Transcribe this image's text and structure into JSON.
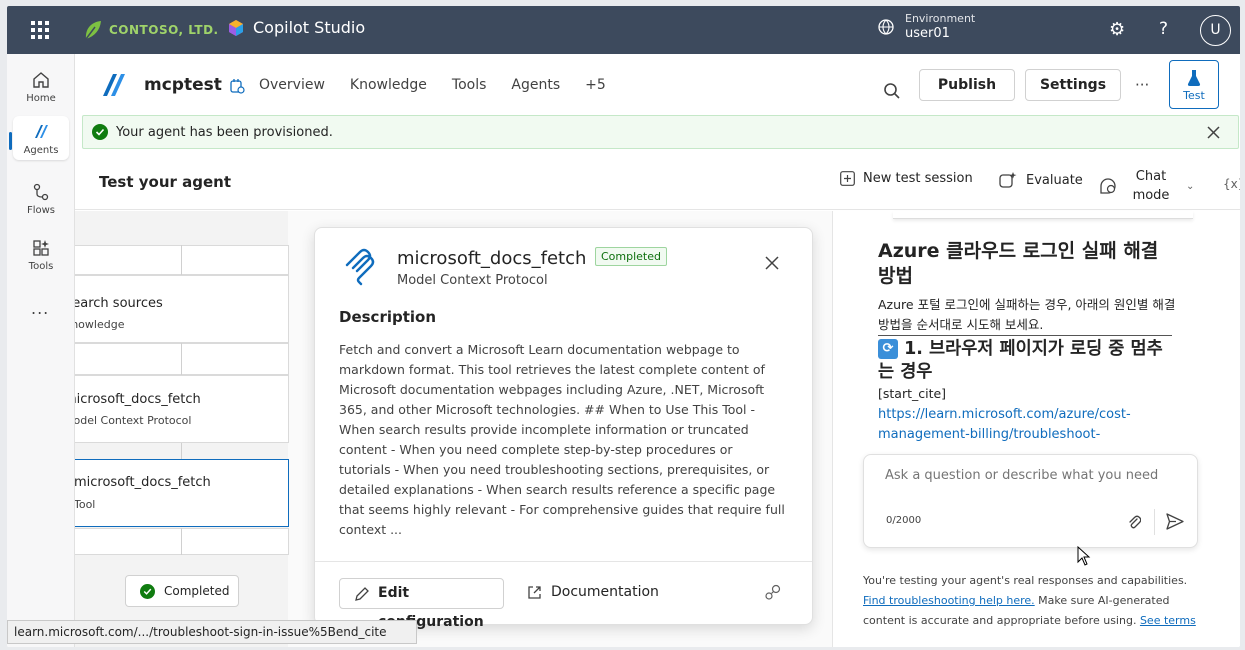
{
  "topbar": {
    "brand": "CONTOSO, LTD.",
    "product": "Copilot Studio",
    "env_label": "Environment",
    "env_user": "user01",
    "avatar_initial": "U"
  },
  "rail": {
    "items": [
      {
        "label": "Home",
        "icon": "home-icon"
      },
      {
        "label": "Agents",
        "icon": "agents-icon"
      },
      {
        "label": "Flows",
        "icon": "flows-icon"
      },
      {
        "label": "Tools",
        "icon": "tools-icon"
      }
    ],
    "more": "..."
  },
  "agent": {
    "name": "mcptest",
    "nav": [
      "Overview",
      "Knowledge",
      "Tools",
      "Agents",
      "+5"
    ],
    "publish": "Publish",
    "settings": "Settings",
    "more": "···",
    "test": "Test"
  },
  "banner": {
    "text": "Your agent has been provisioned."
  },
  "test_panel": {
    "title": "Test your agent",
    "new_session": "New test session",
    "evaluate": "Evaluate",
    "chat_mode": "Chat mode",
    "vars": "{x}"
  },
  "canvas": {
    "nodes": [
      {
        "title": "Search sources",
        "sub": "Knowledge"
      },
      {
        "title": "microsoft_docs_fetch",
        "sub": "Model Context Protocol"
      },
      {
        "title": "microsoft_docs_fetch",
        "sub": "Tool"
      }
    ],
    "completed": "Completed"
  },
  "card": {
    "title": "microsoft_docs_fetch",
    "badge": "Completed",
    "subtitle": "Model Context Protocol",
    "desc_heading": "Description",
    "description": "Fetch and convert a Microsoft Learn documentation webpage to markdown format. This tool retrieves the latest complete content of Microsoft documentation webpages including Azure, .NET, Microsoft 365, and other Microsoft technologies. ## When to Use This Tool - When search results provide incomplete information or truncated content - When you need complete step-by-step procedures or tutorials - When you need troubleshooting sections, prerequisites, or detailed explanations - When search results reference a specific page that seems highly relevant - For comprehensive guides that require full context ...",
    "edit": "Edit configuration",
    "docs": "Documentation"
  },
  "chat": {
    "heading": "Azure 클라우드 로그인 실패 해결 방법",
    "intro": "Azure 포털 로그인에 실패하는 경우, 아래의 원인별 해결 방법을 순서대로 시도해 보세요.",
    "section": "1. 브라우저 페이지가 로딩 중 멈추는 경우",
    "cite": "[start_cite]",
    "link": "https://learn.microsoft.com/azure/cost-management-billing/troubleshoot-",
    "input_placeholder": "Ask a question or describe what you need",
    "counter": "0/2000",
    "disclaimer_1": "You're testing your agent's real responses and capabilities. ",
    "disclaimer_link_1": "Find troubleshooting help here.",
    "disclaimer_2": " Make sure AI-generated content is accurate and appropriate before using. ",
    "disclaimer_link_2": "See terms"
  },
  "status_url": "learn.microsoft.com/.../troubleshoot-sign-in-issue%5Bend_cite",
  "colors": {
    "topbar": "#3d4a5d",
    "accent": "#0f6cbd",
    "success": "#107c10"
  }
}
